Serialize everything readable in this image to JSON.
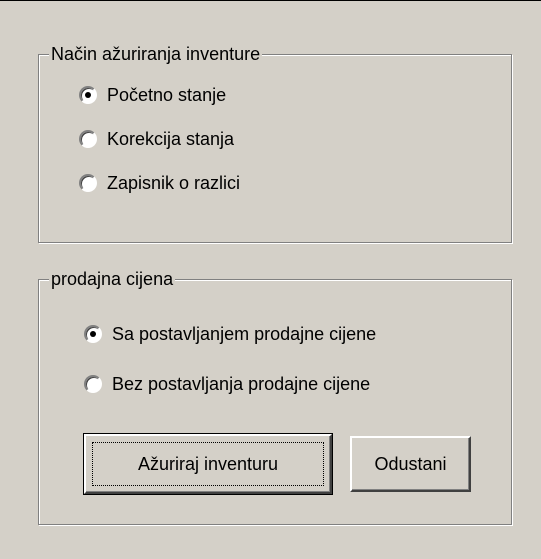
{
  "update_group": {
    "legend": "Način ažuriranja inventure",
    "options": [
      {
        "label": "Početno stanje",
        "checked": true
      },
      {
        "label": "Korekcija stanja",
        "checked": false
      },
      {
        "label": "Zapisnik o razlici",
        "checked": false
      }
    ]
  },
  "price_group": {
    "legend": "prodajna cijena",
    "options": [
      {
        "label": "Sa postavljanjem prodajne cijene",
        "checked": true
      },
      {
        "label": "Bez postavljanja prodajne cijene",
        "checked": false
      }
    ]
  },
  "buttons": {
    "update_label": "Ažuriraj inventuru",
    "cancel_label": "Odustani"
  },
  "colors": {
    "dialog_background": "#d4d0c8",
    "shadow": "#808080",
    "highlight": "#ffffff"
  }
}
